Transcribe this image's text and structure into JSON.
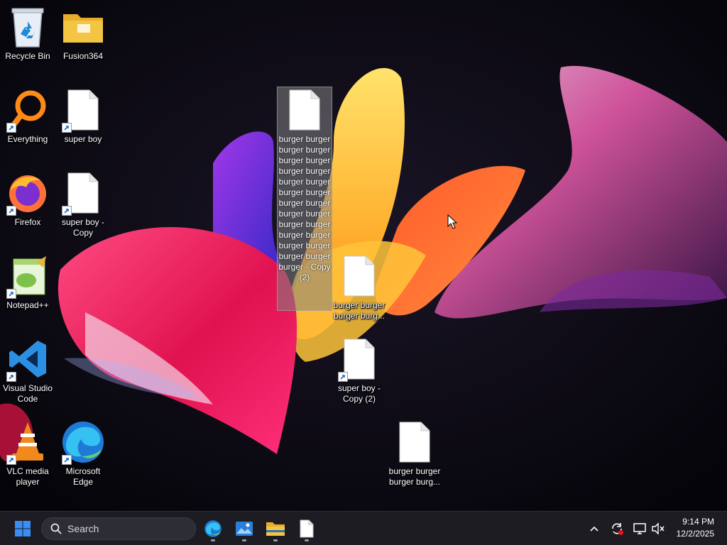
{
  "desktop": {
    "icons": {
      "recycle_bin": "Recycle Bin",
      "fusion360": "Fusion364",
      "everything": "Everything",
      "super_boy": "super boy",
      "firefox": "Firefox",
      "super_boy_copy": "super boy - Copy",
      "notepadpp": "Notepad++",
      "vscode": "Visual Studio Code",
      "vlc": "VLC media player",
      "edge": "Microsoft Edge",
      "burger_copy2": "burger burger burger burger burger burger burger burger burger burger burger burger burger burger burger burger burger burger burger burger burger burger burger burger burger - Copy (2)",
      "burger_a": "burger burger burger burg...",
      "super_boy_copy2": "super boy - Copy (2)",
      "burger_b": "burger burger burger burg..."
    }
  },
  "taskbar": {
    "search_placeholder": "Search",
    "time": "9:14 PM",
    "date": "12/2/2025",
    "pinned": [
      "start-button",
      "edge",
      "photos",
      "file-explorer",
      "text-file"
    ]
  },
  "colors": {
    "taskbar_bg": "#1c1c22",
    "start_blue": "#3a8df5",
    "folder_yellow": "#f4c542",
    "edge_blue": "#1e7ad6",
    "vscode_blue": "#2b8fe3",
    "vlc_orange": "#f08a1d",
    "firefox_orange": "#ff7139"
  }
}
